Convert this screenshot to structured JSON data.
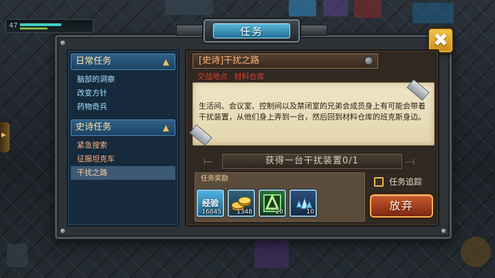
{
  "hud": {
    "level": "47"
  },
  "window": {
    "title": "任务"
  },
  "quest_list": {
    "categories": [
      {
        "label": "日常任务",
        "items": [
          "脑部的洞察",
          "改变方针",
          "药物奇兵"
        ]
      },
      {
        "label": "史诗任务",
        "items": [
          "紧急搜索",
          "征服坦克车",
          "干扰之路"
        ]
      }
    ],
    "selected": "干扰之路"
  },
  "quest_detail": {
    "title": "[史诗]干扰之路",
    "location_label": "交战地点",
    "location_value": "材料仓库",
    "description": "生活间、会议室、控制间以及禁闭室的兄弟会成员身上有可能会带着干扰装置，从他们身上弄到一台，然后回到材料仓库的班克斯身边。",
    "objective": "获得一台干扰装置0/1"
  },
  "rewards": {
    "label": "任务奖励",
    "items": [
      {
        "icon": "exp-icon",
        "label": "经验",
        "qty": "16845"
      },
      {
        "icon": "gold-coins-icon",
        "qty": "1348"
      },
      {
        "icon": "green-crystal-icon",
        "qty": "20"
      },
      {
        "icon": "blue-crystals-icon",
        "qty": "10"
      }
    ]
  },
  "track": {
    "label": "任务追踪",
    "checked": false
  },
  "buttons": {
    "abandon": "放弃",
    "close": "✖"
  },
  "colors": {
    "accent_gold": "#f2c15a",
    "title_blue": "#3d93b8",
    "abandon_red": "#a23b1c"
  }
}
